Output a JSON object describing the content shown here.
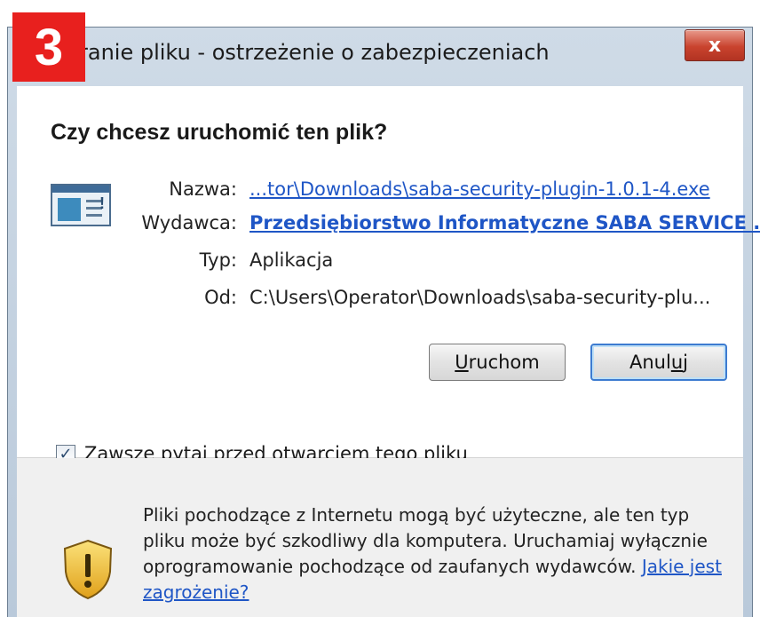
{
  "badge": "3",
  "window": {
    "title": "ranie pliku - ostrzeżenie o zabezpieczeniach",
    "close_glyph": "x"
  },
  "question": "Czy chcesz uruchomić ten plik?",
  "fields": {
    "name_label": "Nazwa:",
    "name_value": "...tor\\Downloads\\saba-security-plugin-1.0.1-4.exe",
    "publisher_label": "Wydawca:",
    "publisher_value": "Przedsiębiorstwo Informatyczne SABA SERVICE ...",
    "type_label": "Typ:",
    "type_value": "Aplikacja",
    "from_label": "Od:",
    "from_value": "C:\\Users\\Operator\\Downloads\\saba-security-plu..."
  },
  "buttons": {
    "run_mnemonic": "U",
    "run_rest": "ruchom",
    "cancel_pre": "Anul",
    "cancel_mnemonic": "u",
    "cancel_post": "j"
  },
  "checkbox": {
    "checked": true,
    "label_pre": "Z",
    "label_mnemonic": "a",
    "label_rest": "wsze pytaj przed otwarciem tego pliku"
  },
  "warning": {
    "text": "Pliki pochodzące z Internetu mogą być użyteczne, ale ten typ pliku może być szkodliwy dla komputera. Uruchamiaj wyłącznie oprogramowanie pochodzące od zaufanych wydawców. ",
    "link": "Jakie jest zagrożenie?"
  },
  "icons": {
    "app": "application-icon",
    "shield": "warning-shield-icon"
  },
  "colors": {
    "badge": "#e8201e",
    "link": "#1f56c6",
    "close": "#c9432e",
    "default_button_border": "#3d7bd0"
  }
}
